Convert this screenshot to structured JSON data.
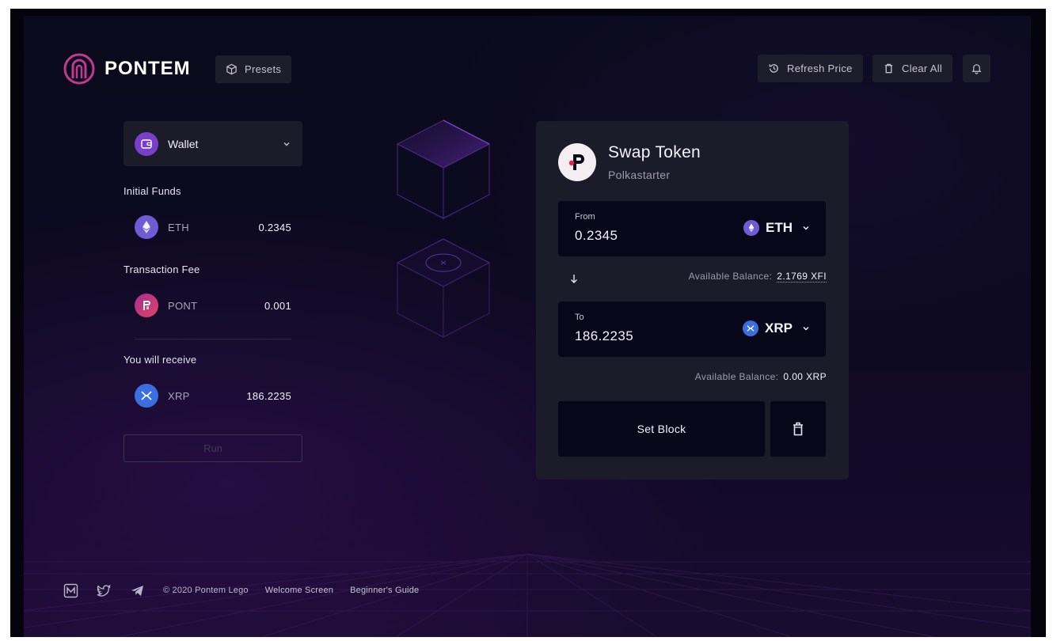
{
  "header": {
    "logo_text": "PONTEM",
    "presets_label": "Presets",
    "refresh_label": "Refresh Price",
    "clear_label": "Clear All"
  },
  "sidebar": {
    "wallet_label": "Wallet",
    "initial_funds": {
      "title": "Initial Funds",
      "symbol": "ETH",
      "value": "0.2345"
    },
    "transaction_fee": {
      "title": "Transaction Fee",
      "symbol": "PONT",
      "value": "0.001"
    },
    "receive": {
      "title": "You will receive",
      "symbol": "XRP",
      "value": "186.2235"
    },
    "run_label": "Run"
  },
  "swap": {
    "title": "Swap Token",
    "subtitle": "Polkastarter",
    "from": {
      "label": "From",
      "value": "0.2345",
      "token": "ETH"
    },
    "from_balance": {
      "label": "Available Balance:",
      "value": "2.1769 XFI"
    },
    "to": {
      "label": "To",
      "value": "186.2235",
      "token": "XRP"
    },
    "to_balance": {
      "label": "Available Balance:",
      "value": "0.00 XRP"
    },
    "set_block_label": "Set Block"
  },
  "footer": {
    "copyright": "© 2020 Pontem Lego",
    "links": [
      "Welcome Screen",
      "Beginner's Guide"
    ]
  },
  "colors": {
    "accent": "#7a3fc9",
    "eth": "#6f5bd3",
    "pont": "#c2337d",
    "xrp": "#3b6fe0",
    "card": "#1c1b29",
    "field": "#08071a"
  },
  "icons": [
    "pontem-logo",
    "cube-icon",
    "history-icon",
    "trash-icon",
    "bell-icon",
    "wallet-icon",
    "chevron-down-icon",
    "eth-icon",
    "pont-icon",
    "xrp-icon",
    "arrow-down-icon",
    "medium-icon",
    "twitter-icon",
    "telegram-icon"
  ]
}
